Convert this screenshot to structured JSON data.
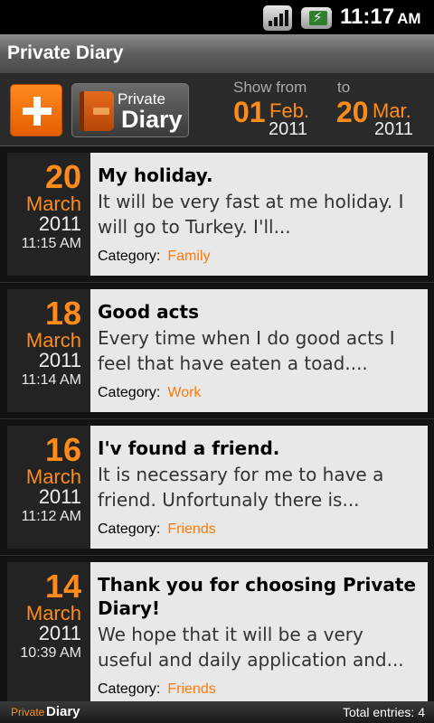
{
  "status_bar": {
    "time": "11:17",
    "ampm": "AM",
    "icons": [
      "signal-icon",
      "battery-charging-icon"
    ]
  },
  "title_bar": {
    "title": "Private Diary"
  },
  "toolbar": {
    "add_icon": "plus-icon",
    "logo_line1": "Private",
    "logo_line2": "Diary",
    "show_from_label": "Show from",
    "to_label": "to",
    "from_day": "01",
    "from_month": "Feb.",
    "from_year": "2011",
    "to_day": "20",
    "to_month": "Mar.",
    "to_year": "2011"
  },
  "entries": [
    {
      "day": "20",
      "month": "March",
      "year": "2011",
      "time": "11:15 AM",
      "title": "My holiday.",
      "text": "It will be very fast at me holiday. I will go to Turkey. I'll...",
      "category_label": "Category:",
      "category": "Family"
    },
    {
      "day": "18",
      "month": "March",
      "year": "2011",
      "time": "11:14 AM",
      "title": "Good acts",
      "text": "Every time when I do good acts I feel that have eaten a toad....",
      "category_label": "Category:",
      "category": "Work"
    },
    {
      "day": "16",
      "month": "March",
      "year": "2011",
      "time": "11:12 AM",
      "title": "I'v found a friend.",
      "text": "It is necessary for me to have a friend. Unfortunaly there is...",
      "category_label": "Category:",
      "category": "Friends"
    },
    {
      "day": "14",
      "month": "March",
      "year": "2011",
      "time": "10:39 AM",
      "title": "Thank you for choosing Private Diary!",
      "text": "We hope that it will be a very useful and daily application and...",
      "category_label": "Category:",
      "category": "Friends"
    }
  ],
  "footer": {
    "brand_small": "Private",
    "brand_big": "Diary",
    "total": "Total entries: 4"
  },
  "colors": {
    "accent": "#ff8c1a",
    "card_bg": "#e8e8e8",
    "date_bg": "#232323"
  }
}
